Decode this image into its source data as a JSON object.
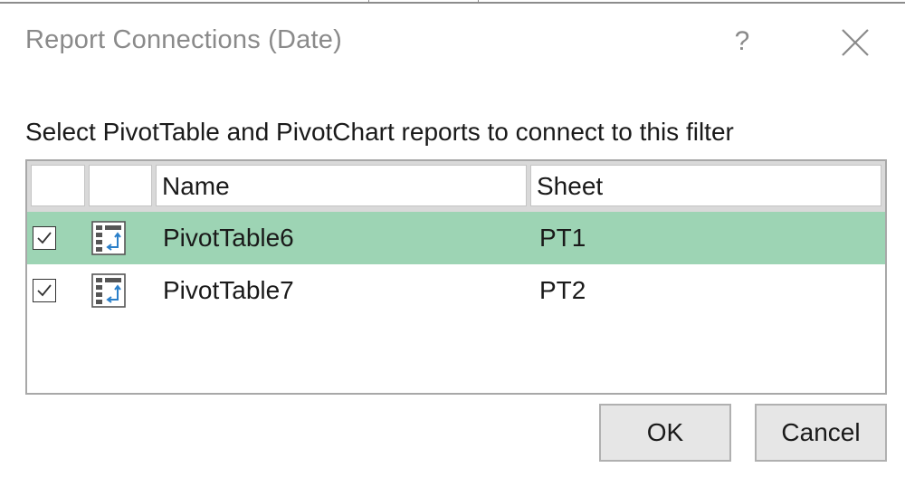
{
  "dialog": {
    "title": "Report Connections (Date)",
    "help_glyph": "?",
    "instruction": "Select PivotTable and PivotChart reports to connect to this filter"
  },
  "table": {
    "columns": [
      "Name",
      "Sheet"
    ],
    "rows": [
      {
        "name": "PivotTable6",
        "sheet": "PT1",
        "checked": true,
        "selected": true
      },
      {
        "name": "PivotTable7",
        "sheet": "PT2",
        "checked": true,
        "selected": false
      }
    ]
  },
  "buttons": {
    "ok": "OK",
    "cancel": "Cancel"
  },
  "colors": {
    "selected_row": "#9dd4b4",
    "pivot_icon_arrow": "#2a7fc9",
    "title_text": "#8a8a8a"
  },
  "icons": {
    "row_icon": "pivot-table-icon",
    "checkbox_mark": "checkmark-icon",
    "close": "close-icon"
  }
}
